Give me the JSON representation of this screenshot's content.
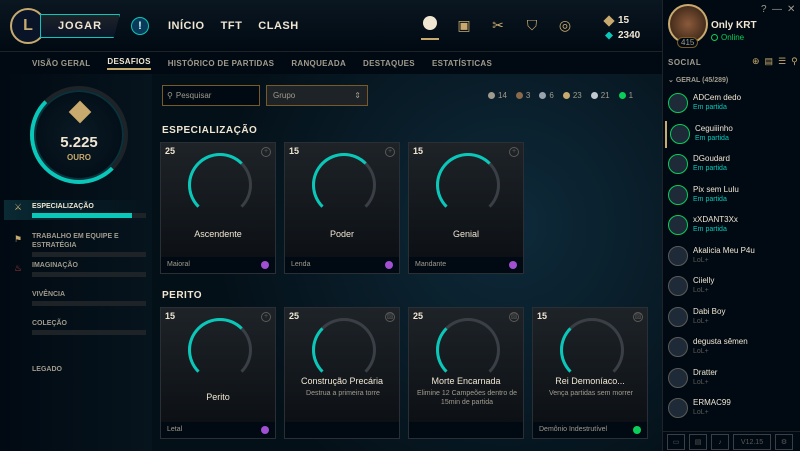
{
  "topbar": {
    "play_label": "JOGAR",
    "alert_label": "!",
    "nav": [
      "INÍCIO",
      "TFT",
      "CLASH"
    ],
    "icons": [
      "profile-icon",
      "collection-icon",
      "loot-icon",
      "clash-icon",
      "store-icon"
    ],
    "rp": "15",
    "be": "2340"
  },
  "profile": {
    "name": "Only KRT",
    "status": "Online",
    "level": "415",
    "help": "?",
    "minimize": "—",
    "close": "✕"
  },
  "subnav": {
    "tabs": [
      "VISÃO GERAL",
      "DESAFIOS",
      "HISTÓRICO DE PARTIDAS",
      "RANQUEADA",
      "DESTAQUES",
      "ESTATÍSTICAS"
    ],
    "selected": "DESAFIOS"
  },
  "summary": {
    "total": "5.225",
    "rank": "OURO"
  },
  "categories": [
    {
      "label": "ESPECIALIZAÇÃO",
      "progress": 0.88
    },
    {
      "label": "TRABALHO EM EQUIPE E ESTRATÉGIA",
      "progress": 0.0
    },
    {
      "label": "IMAGINAÇÃO",
      "progress": 0.0
    },
    {
      "label": "VIVÊNCIA",
      "progress": 0.0
    },
    {
      "label": "COLEÇÃO",
      "progress": 0.0
    }
  ],
  "legacy": "LEGADO",
  "filters": {
    "search_placeholder": "Pesquisar",
    "group_label": "Grupo",
    "counts": [
      {
        "value": "14",
        "color": "#a09b8c"
      },
      {
        "value": "3",
        "color": "#8a6a4a"
      },
      {
        "value": "6",
        "color": "#9aa4af"
      },
      {
        "value": "23",
        "color": "#c8aa6e"
      },
      {
        "value": "21",
        "color": "#c0c8d0"
      },
      {
        "value": "1",
        "color": "#0acd5a"
      }
    ]
  },
  "sections": [
    {
      "title": "ESPECIALIZAÇÃO",
      "cards": [
        {
          "points": "25",
          "title": "Ascendente",
          "desc": "",
          "footer": "Maioral",
          "badge": "#a050d0",
          "progress": 0.82
        },
        {
          "points": "15",
          "title": "Poder",
          "desc": "",
          "footer": "Lenda",
          "badge": "#a050d0",
          "progress": 0.6
        },
        {
          "points": "15",
          "title": "Genial",
          "desc": "",
          "footer": "Mandante",
          "badge": "#a050d0",
          "progress": 0.7
        }
      ]
    },
    {
      "title": "PERITO",
      "cards": [
        {
          "points": "15",
          "title": "Perito",
          "desc": "",
          "footer": "Letal",
          "badge": "#a050d0",
          "progress": 0.7
        },
        {
          "points": "25",
          "title": "Construção Precária",
          "desc": "Destrua a primeira torre",
          "footer": "",
          "badge": "",
          "progress": 0.3
        },
        {
          "points": "25",
          "title": "Morte Encarnada",
          "desc": "Elimine 12 Campeões dentro de 15min de partida",
          "footer": "",
          "badge": "",
          "progress": 0.3
        },
        {
          "points": "15",
          "title": "Rei Demoníaco...",
          "desc": "Vença partidas sem morrer",
          "footer": "Demônio Indestrutível",
          "badge": "#0acd5a",
          "progress": 0.3
        }
      ]
    }
  ],
  "social": {
    "header": "SOCIAL",
    "group": "GERAL (45/289)",
    "friends": [
      {
        "name": "ADCem dedo",
        "status": "Em partida"
      },
      {
        "name": "Ceguiiinho",
        "status": "Em partida"
      },
      {
        "name": "DGoudard",
        "status": "Em partida"
      },
      {
        "name": "Pix sem Lulu",
        "status": "Em partida"
      },
      {
        "name": "xXDANT3Xx",
        "status": "Em partida"
      },
      {
        "name": "Akalicia Meu P4u",
        "status": "LoL+"
      },
      {
        "name": "Ciielly",
        "status": "LoL+"
      },
      {
        "name": "Dabi Boy",
        "status": "LoL+"
      },
      {
        "name": "degusta sêmen",
        "status": "LoL+"
      },
      {
        "name": "Dratter",
        "status": "LoL+"
      },
      {
        "name": "ERMAC99",
        "status": "LoL+"
      }
    ],
    "version": "V12.15"
  }
}
